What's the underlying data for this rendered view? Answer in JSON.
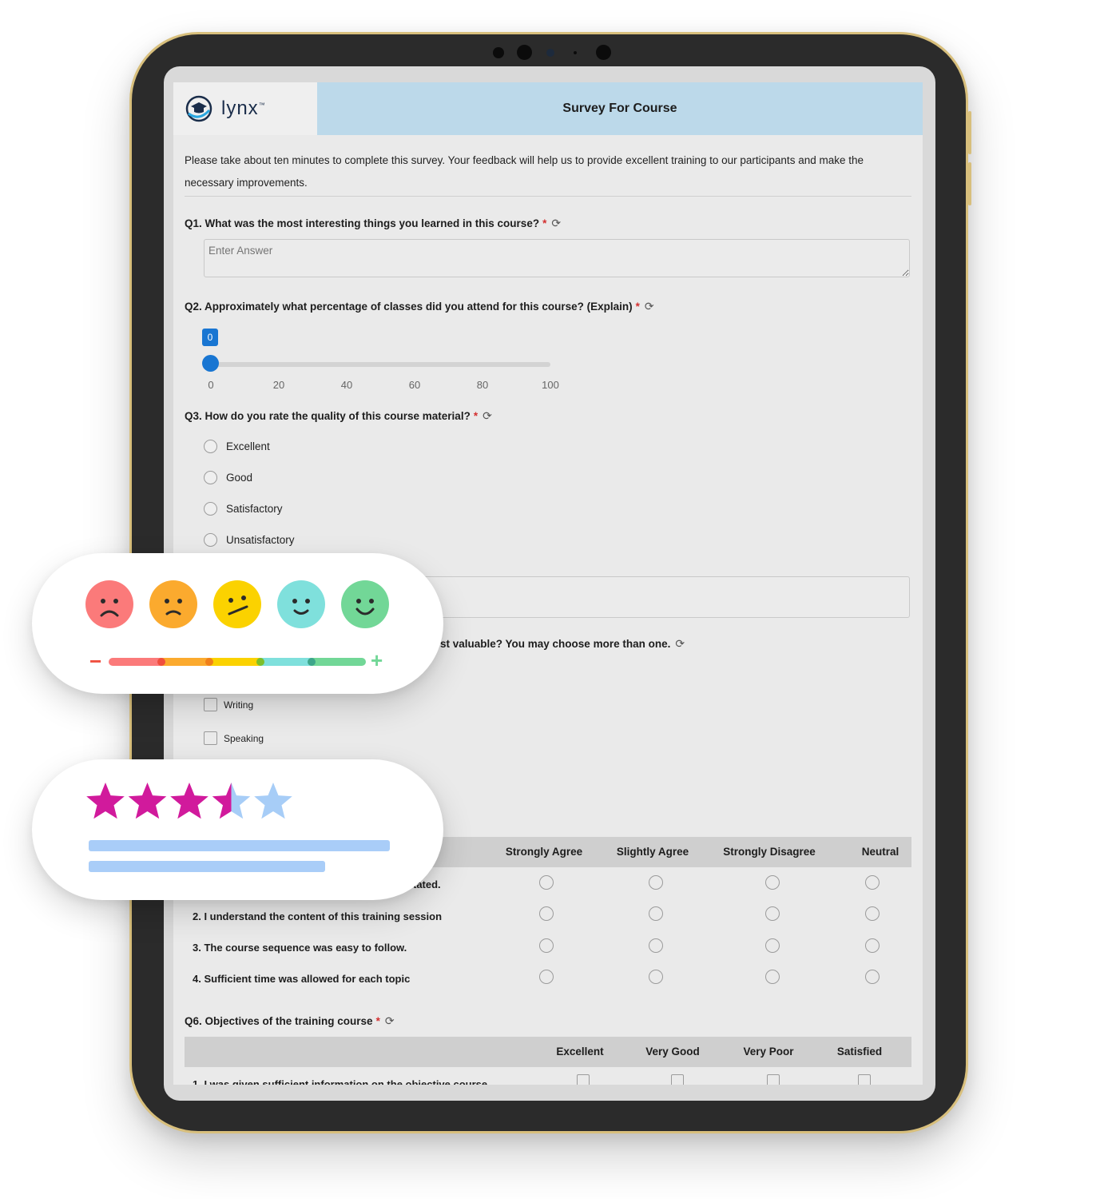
{
  "header": {
    "logo_text": "lynx",
    "logo_tm": "™",
    "title": "Survey For Course"
  },
  "intro": "Please take about ten minutes to complete this survey. Your feedback will help us to provide excellent training to our participants and make the necessary improvements.",
  "required_mark": "*",
  "q1": {
    "label": "Q1. What was the most interesting things you learned in this course?",
    "placeholder": "Enter Answer"
  },
  "q2": {
    "label": "Q2. Approximately what percentage of classes did you attend for this course? (Explain)",
    "slider_value": "0",
    "ticks": [
      "0",
      "20",
      "40",
      "60",
      "80",
      "100"
    ]
  },
  "q3": {
    "label": "Q3. How do you rate the quality of this course material?",
    "options": [
      "Excellent",
      "Good",
      "Satisfactory",
      "Unsatisfactory"
    ]
  },
  "q4_partial_label": "st valuable? You may choose more than one.",
  "q4_options": [
    "Writing",
    "Speaking"
  ],
  "q5": {
    "columns": [
      "Strongly Agree",
      "Slightly Agree",
      "Strongly Disagree",
      "Neutral"
    ],
    "row1_partial": "tated.",
    "rows": [
      "2. I understand the content of this training session",
      "3. The course sequence was easy to follow.",
      "4. Sufficient time was allowed for each topic"
    ]
  },
  "q6": {
    "label": "Q6. Objectives of the training course",
    "columns": [
      "Excellent",
      "Very Good",
      "Very Poor",
      "Satisfied"
    ],
    "row1": "1. I was given sufficient information on the objective course"
  },
  "emoji_card": {
    "faces": [
      "very-sad",
      "sad",
      "neutral",
      "happy",
      "very-happy"
    ],
    "colors": [
      "#fb7a7a",
      "#fbaa2e",
      "#fbd200",
      "#7fe0dc",
      "#72d797"
    ],
    "minus_symbol": "−",
    "plus_symbol": "+"
  },
  "rating_card": {
    "rating": 3.5,
    "max": 5,
    "filled_color": "#d11a9c",
    "empty_color": "#a7cdf7"
  }
}
